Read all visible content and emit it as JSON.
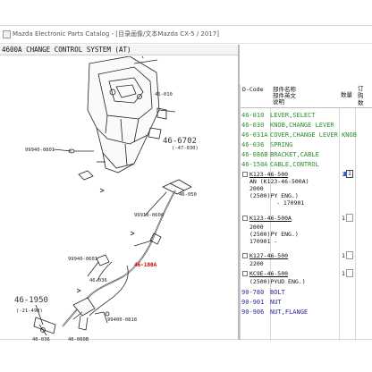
{
  "window": {
    "title": "Mazda Electronic Parts Catalog - [目录画像/文本Mazda CX-5 / 2017]"
  },
  "header": {
    "group_title": "4600A  CHANGE CONTROL SYSTEM (AT)"
  },
  "diagram": {
    "callouts": [
      "46-010",
      "46-6702",
      "(-47-030)",
      "99940-0801",
      "99910-0600",
      "46-050",
      "99940-0601",
      "46-180A",
      "46-036",
      "46-060B",
      "99400-0818",
      "46-1950",
      "(-21-490)",
      "46-036"
    ]
  },
  "table": {
    "headers": {
      "code": "D-Code",
      "name_1": "部件名称",
      "name_2": "部件英文",
      "name_3": "说明",
      "qty": "数量",
      "order_1": "订",
      "order_2": "购",
      "order_3": "数"
    },
    "rows": [
      {
        "code": "46-010",
        "name": "LEVER,SELECT"
      },
      {
        "code": "46-030",
        "name": "KNOB,CHANGE LEVER"
      },
      {
        "code": "46-031A",
        "name": "COVER,CHANGE LEVER KNOB"
      },
      {
        "code": "46-036",
        "name": "SPRING"
      },
      {
        "code": "46-086B",
        "name": "BRACKET,CABLE"
      },
      {
        "code": "46-150A",
        "name": "CABLE,CONTROL"
      }
    ],
    "parts": [
      {
        "number": "K123-46-500",
        "lines": [
          "AN (K123-46-500A)",
          "2000",
          "(2500)PY ENG.)",
          "- 170901"
        ],
        "qty": "1",
        "order": "1"
      },
      {
        "number": "K123-46-500A",
        "lines": [
          "2000",
          "(2500)PY ENG.)",
          "170901 -"
        ],
        "qty": "1",
        "order": ""
      },
      {
        "number": "K127-46-500",
        "lines": [
          "2200"
        ],
        "qty": "1",
        "order": ""
      },
      {
        "number": "KC9E-46-500",
        "lines": [
          "(2500)PYUD ENG.)"
        ],
        "qty": "1",
        "order": ""
      }
    ],
    "bottom_rows": [
      {
        "code": "90-780",
        "name": "BOLT"
      },
      {
        "code": "90-901",
        "name": "NUT"
      },
      {
        "code": "90-906",
        "name": "NUT,FLANGE"
      }
    ]
  }
}
